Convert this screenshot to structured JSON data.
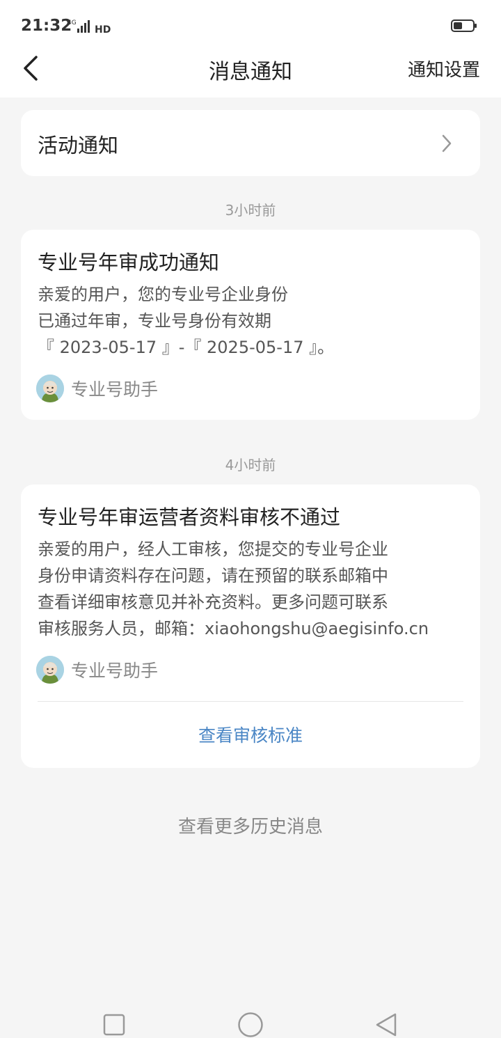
{
  "status_bar": {
    "time": "21:32",
    "network": "4G",
    "hd": "HD"
  },
  "nav": {
    "title": "消息通知",
    "settings_label": "通知设置"
  },
  "activity": {
    "label": "活动通知"
  },
  "messages": [
    {
      "time_label": "3小时前",
      "title": "专业号年审成功通知",
      "body_lines": [
        "亲爱的用户，您的专业号企业身份",
        "已通过年审，专业号身份有效期",
        "『 2023-05-17 』-『 2025-05-17 』。"
      ],
      "sender": "专业号助手"
    },
    {
      "time_label": "4小时前",
      "title": "专业号年审运营者资料审核不通过",
      "body_lines": [
        "亲爱的用户，经人工审核，您提交的专业号企业",
        "身份申请资料存在问题，请在预留的联系邮箱中",
        "查看详细审核意见并补充资料。更多问题可联系",
        "审核服务人员，邮箱：xiaohongshu@aegisinfo.cn"
      ],
      "sender": "专业号助手",
      "action_label": "查看审核标准"
    }
  ],
  "footer": {
    "more_history": "查看更多历史消息"
  },
  "colors": {
    "background": "#f5f5f5",
    "card": "#ffffff",
    "link": "#4a86c5",
    "muted": "#999999"
  },
  "icons": [
    "back-arrow-icon",
    "chevron-right-icon",
    "assistant-avatar",
    "recent-apps-icon",
    "home-icon",
    "back-icon"
  ]
}
